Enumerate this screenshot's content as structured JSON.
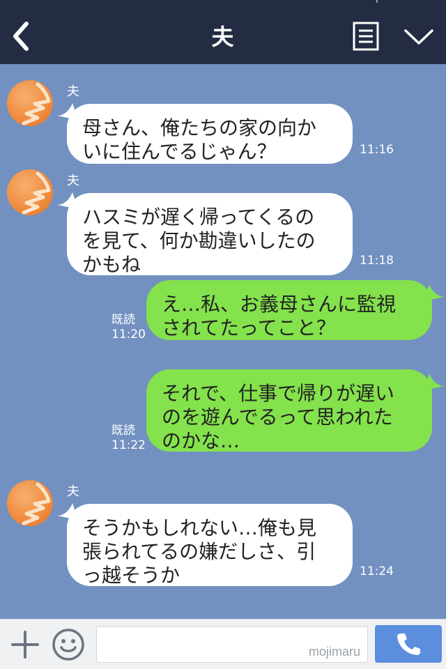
{
  "header": {
    "title": "夫"
  },
  "messages": [
    {
      "sender": "夫",
      "text": "母さん、俺たちの家の向か\nいに住んでるじゃん？",
      "time": "11:16"
    },
    {
      "sender": "夫",
      "text": "ハスミが遅く帰ってくるの\nを見て、何か勘違いしたの\nかもね",
      "time": "11:18"
    },
    {
      "text": "え…私、お義母さんに監視\nされてたってこと？",
      "read": "既読",
      "time": "11:20"
    },
    {
      "text": "それで、仕事で帰りが遅い\nのを遊んでるって思われた\nのかな…",
      "read": "既読",
      "time": "11:22"
    },
    {
      "sender": "夫",
      "text": "そうかもしれない…俺も見\n張られてるの嫌だしさ、引\nっ越そうか",
      "time": "11:24"
    }
  ],
  "footer": {
    "input_value": "",
    "watermark": "mojimaru"
  },
  "icons": [
    "back-icon",
    "menu-icon",
    "chevron-down-icon",
    "plus-icon",
    "emoji-icon",
    "phone-icon"
  ],
  "colors": {
    "header_bg": "#232c42",
    "chat_bg": "#7291c1",
    "incoming_bubble": "#ffffff",
    "outgoing_bubble": "#84e24c",
    "call_button": "#5b8fdd"
  }
}
